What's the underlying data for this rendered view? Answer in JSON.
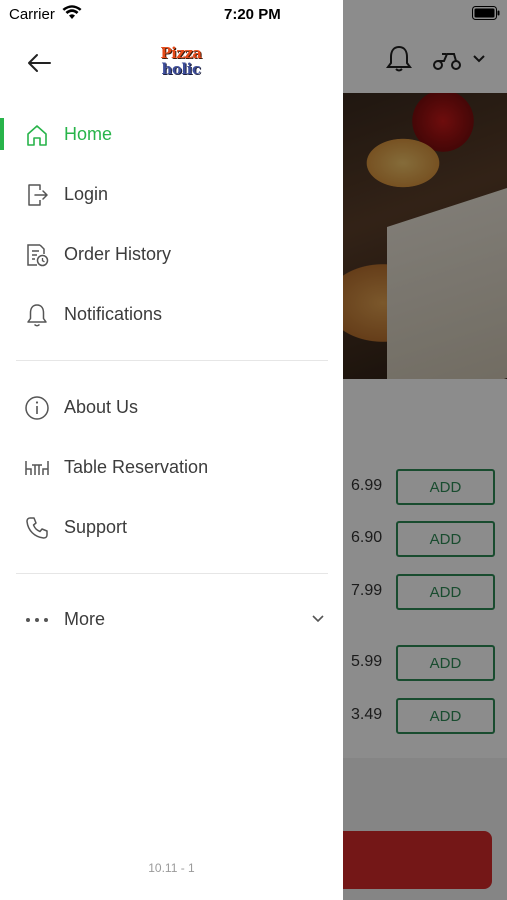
{
  "status_bar": {
    "carrier": "Carrier",
    "time": "7:20 PM"
  },
  "drawer": {
    "logo": {
      "line1": "Pizza",
      "line2": "holic"
    },
    "back_icon": "arrow-left-icon",
    "menu": [
      {
        "label": "Home",
        "icon": "home-icon",
        "active": true
      },
      {
        "label": "Login",
        "icon": "login-icon",
        "active": false
      },
      {
        "label": "Order History",
        "icon": "order-history-icon",
        "active": false
      },
      {
        "label": "Notifications",
        "icon": "bell-icon",
        "active": false
      }
    ],
    "menu2": [
      {
        "label": "About Us",
        "icon": "info-icon"
      },
      {
        "label": "Table Reservation",
        "icon": "table-icon"
      },
      {
        "label": "Support",
        "icon": "phone-icon"
      }
    ],
    "more": {
      "label": "More",
      "icon": "more-dots-icon"
    },
    "version": "10.11 - 1"
  },
  "background": {
    "items": [
      {
        "price": "6.99",
        "button": "ADD"
      },
      {
        "price": "6.90",
        "button": "ADD"
      },
      {
        "price": "7.99",
        "button": "ADD"
      },
      {
        "price": "5.99",
        "button": "ADD"
      },
      {
        "price": "3.49",
        "button": "ADD"
      }
    ]
  },
  "colors": {
    "accent": "#28b44a",
    "add_button": "#2e8b57",
    "cta": "#d42a2a"
  }
}
